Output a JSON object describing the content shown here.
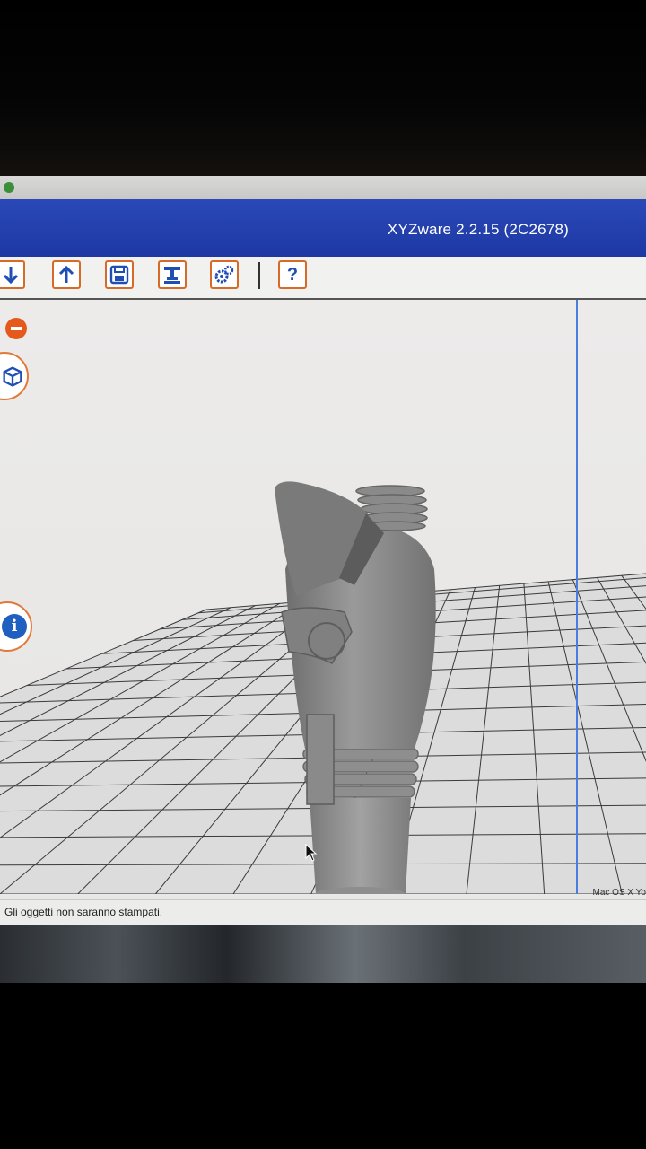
{
  "window": {
    "title": "XYZware 2.2.15 (2C2678)"
  },
  "toolbar": {
    "buttons": [
      {
        "icon": "arrow-down-icon",
        "name": "import-button"
      },
      {
        "icon": "arrow-up-icon",
        "name": "export-button"
      },
      {
        "icon": "save-icon",
        "name": "save-button"
      },
      {
        "icon": "printer-icon",
        "name": "print-button"
      },
      {
        "icon": "gears-icon",
        "name": "settings-button"
      },
      {
        "icon": "question-icon",
        "name": "help-button"
      }
    ],
    "help_glyph": "?"
  },
  "side_controls": {
    "remove_icon": "minus-circle-icon",
    "view_icon": "cube-icon",
    "info_icon": "info-icon",
    "info_glyph": "i"
  },
  "status": {
    "message": "Gli oggetti non saranno stampati.",
    "os_label": "Mac OS X Yo"
  },
  "colors": {
    "title_bar": "#1d38a3",
    "accent_orange": "#d86a28",
    "icon_blue": "#1f4fb5",
    "model_gray": "#8c8c8c"
  }
}
